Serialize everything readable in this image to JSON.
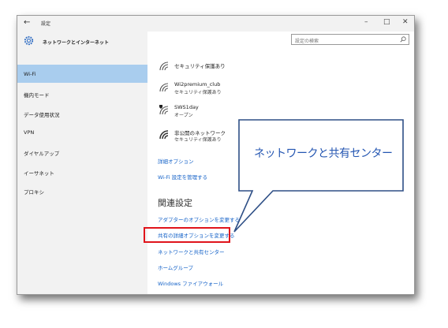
{
  "window": {
    "title": "設定",
    "back_icon": "back-arrow-icon",
    "controls": {
      "minimize": "–",
      "maximize": "□",
      "close": "✕"
    }
  },
  "sidebar": {
    "header": "ネットワークとインターネット",
    "items": [
      {
        "label": "Wi-Fi",
        "selected": true
      },
      {
        "label": "機内モード"
      },
      {
        "label": "データ使用状況"
      },
      {
        "label": "VPN"
      },
      {
        "label": "ダイヤルアップ"
      },
      {
        "label": "イーサネット"
      },
      {
        "label": "プロキシ"
      }
    ]
  },
  "search": {
    "placeholder": "設定の検索"
  },
  "networks": [
    {
      "sub": "セキュリティ保護あり"
    },
    {
      "name": "Wi2premium_club",
      "sub": "セキュリティ保護あり"
    },
    {
      "name": "SWS1day",
      "sub": "オープン"
    },
    {
      "name": "非公開のネットワーク",
      "sub": "セキュリティ保護あり"
    }
  ],
  "links": {
    "advanced_options": "詳細オプション",
    "manage_wifi": "Wi-Fi 設定を管理する"
  },
  "related": {
    "heading": "関連設定",
    "items": [
      "アダプターのオプションを変更する",
      "共有の詳細オプションを変更する",
      "ネットワークと共有センター",
      "ホームグループ",
      "Windows ファイアウォール"
    ]
  },
  "callout": {
    "text": "ネットワークと共有センター"
  },
  "colors": {
    "accent_link": "#1462c8",
    "selected_nav": "#a9cdee",
    "highlight_border": "#e0141b",
    "callout_stroke": "#2e4f86"
  }
}
